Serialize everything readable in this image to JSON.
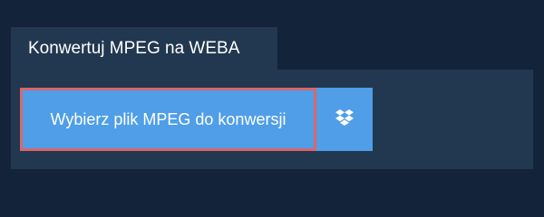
{
  "tab": {
    "title": "Konwertuj MPEG na WEBA"
  },
  "upload": {
    "select_label": "Wybierz plik MPEG do konwersji",
    "dropbox_icon": "dropbox-icon"
  },
  "colors": {
    "background": "#13233a",
    "panel": "#223850",
    "button": "#4f9ee7",
    "focus_border": "#d9676b",
    "text": "#ffffff"
  }
}
